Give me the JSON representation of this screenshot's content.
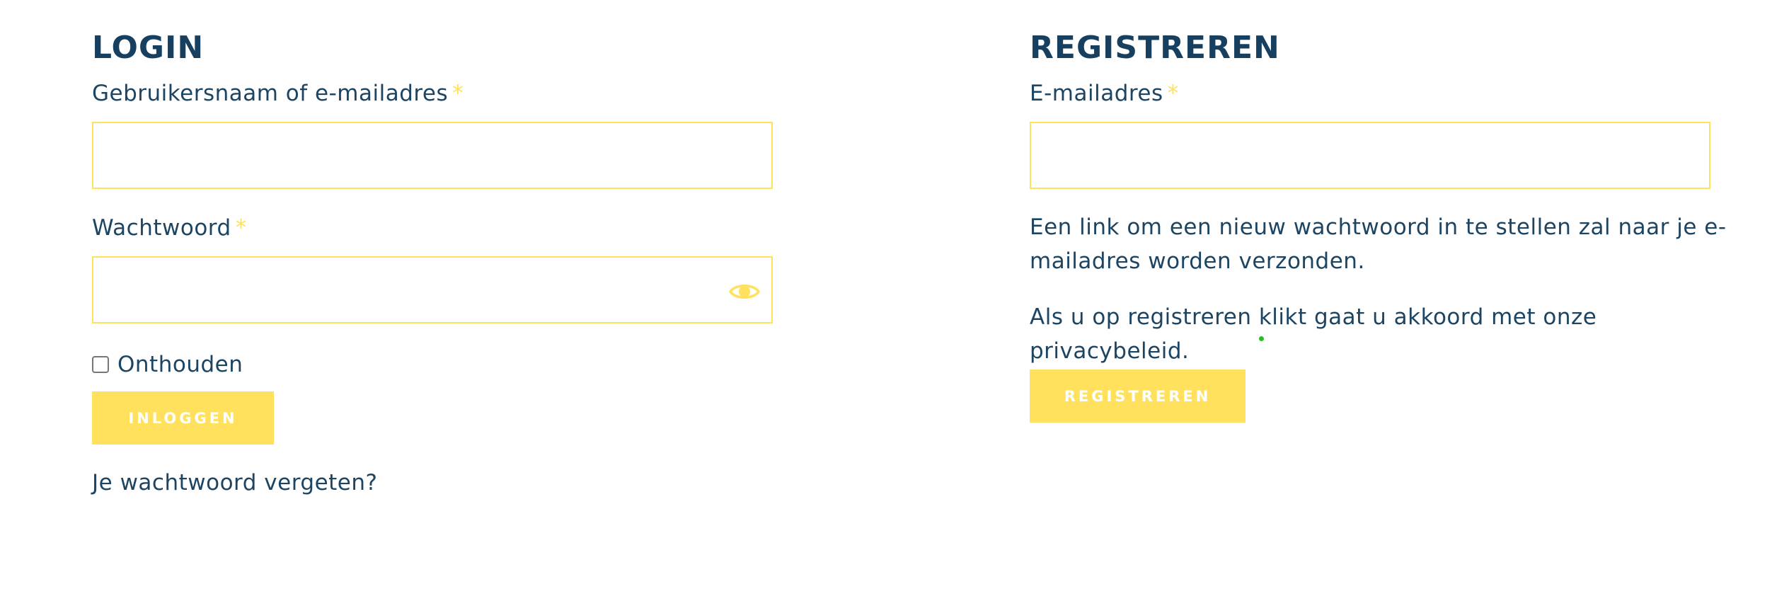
{
  "colors": {
    "heading": "#173f5f",
    "text": "#1c4563",
    "accent": "#ffe15e",
    "required": "#ffe05e"
  },
  "login": {
    "title": "LOGIN",
    "username_label": "Gebruikersnaam of e-mailadres",
    "username_value": "",
    "password_label": "Wachtwoord",
    "password_value": "",
    "required_mark": "*",
    "show_password_icon": "eye-icon",
    "remember_label": "Onthouden",
    "remember_checked": false,
    "submit_label": "INLOGGEN",
    "forgot_link": "Je wachtwoord vergeten?"
  },
  "register": {
    "title": "REGISTREREN",
    "email_label": "E-mailadres",
    "email_value": "",
    "required_mark": "*",
    "info_text": "Een link om een nieuw wachtwoord in te stellen zal naar je e-mailadres worden verzonden.",
    "privacy_text": "Als u op registreren klikt gaat u akkoord met onze privacybeleid.",
    "submit_label": "REGISTREREN"
  }
}
